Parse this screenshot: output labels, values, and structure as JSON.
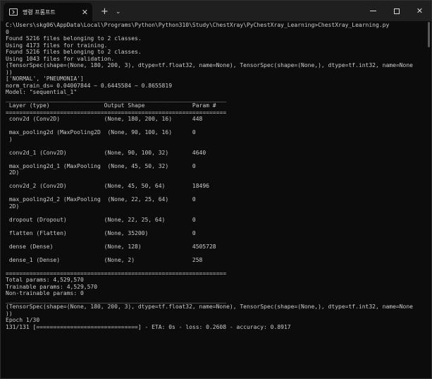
{
  "window": {
    "tab_title": "명령 프롬프트",
    "tab_close": "✕",
    "new_tab": "+",
    "dropdown": "⌄",
    "close": "✕"
  },
  "console": {
    "lines": [
      "C:\\Users\\skg06\\AppData\\Local\\Programs\\Python\\Python310\\Study\\ChestXray\\PyChestXray_Learning>ChestXray_Learning.py",
      "0",
      "Found 5216 files belonging to 2 classes.",
      "Using 4173 files for training.",
      "Found 5216 files belonging to 2 classes.",
      "Using 1043 files for validation.",
      "(TensorSpec(shape=(None, 180, 200, 3), dtype=tf.float32, name=None), TensorSpec(shape=(None,), dtype=tf.int32, name=None",
      "))",
      "['NORMAL', 'PNEUMONIA']",
      "norm_train_ds= 0.04007844 ~ 0.6445584 ~ 0.8655819",
      "Model: \"sequential_1\"",
      "_________________________________________________________________",
      " Layer (type)                Output Shape              Param #",
      "=================================================================",
      " conv2d (Conv2D)             (None, 180, 200, 16)      448",
      "",
      " max_pooling2d (MaxPooling2D  (None, 90, 100, 16)      0",
      " )",
      "",
      " conv2d_1 (Conv2D)           (None, 90, 100, 32)       4640",
      "",
      " max_pooling2d_1 (MaxPooling  (None, 45, 50, 32)       0",
      " 2D)",
      "",
      " conv2d_2 (Conv2D)           (None, 45, 50, 64)        18496",
      "",
      " max_pooling2d_2 (MaxPooling  (None, 22, 25, 64)       0",
      " 2D)",
      "",
      " dropout (Dropout)           (None, 22, 25, 64)        0",
      "",
      " flatten (Flatten)           (None, 35200)             0",
      "",
      " dense (Dense)               (None, 128)               4505728",
      "",
      " dense_1 (Dense)             (None, 2)                 258",
      "",
      "=================================================================",
      "Total params: 4,529,570",
      "Trainable params: 4,529,570",
      "Non-trainable params: 0",
      "_________________________________________________________________",
      "(TensorSpec(shape=(None, 180, 200, 3), dtype=tf.float32, name=None), TensorSpec(shape=(None,), dtype=tf.int32, name=None",
      "))",
      "Epoch 1/30",
      "131/131 [==============================] - ETA: 0s - loss: 0.2608 - accuracy: 0.8917"
    ]
  }
}
